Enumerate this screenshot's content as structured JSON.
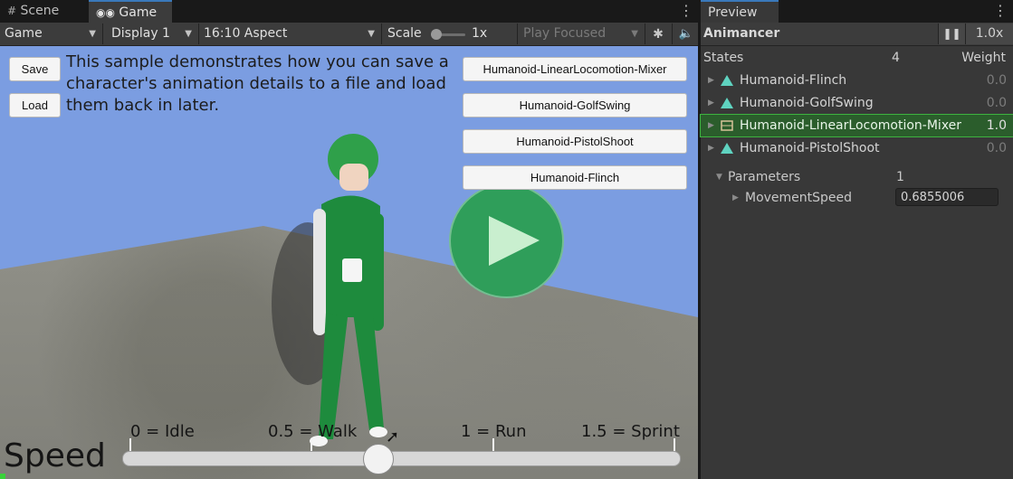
{
  "tabs": {
    "scene": "Scene",
    "game": "Game",
    "preview": "Preview"
  },
  "toolbar": {
    "mode": "Game",
    "display": "Display 1",
    "aspect": "16:10 Aspect",
    "scale_label": "Scale",
    "scale_value": "1x",
    "play_mode": "Play Focused"
  },
  "game": {
    "save_label": "Save",
    "load_label": "Load",
    "description": "This sample demonstrates how you can save a character's animation details to a file and load them back in later.",
    "animation_buttons": [
      "Humanoid-LinearLocomotion-Mixer",
      "Humanoid-GolfSwing",
      "Humanoid-PistolShoot",
      "Humanoid-Flinch"
    ],
    "speed_label": "Speed",
    "speed_value": 0.6855006,
    "speed_ticks": [
      {
        "label": "0 = Idle",
        "value": 0
      },
      {
        "label": "0.5 = Walk",
        "value": 0.5
      },
      {
        "label": "1 = Run",
        "value": 1
      },
      {
        "label": "1.5 = Sprint",
        "value": 1.5
      }
    ]
  },
  "preview": {
    "title": "Animancer",
    "speed": "1.0x",
    "states_label": "States",
    "states_count": "4",
    "weight_label": "Weight",
    "states": [
      {
        "name": "Humanoid-Flinch",
        "weight": "0.0",
        "active": false
      },
      {
        "name": "Humanoid-GolfSwing",
        "weight": "0.0",
        "active": false
      },
      {
        "name": "Humanoid-LinearLocomotion-Mixer",
        "weight": "1.0",
        "active": true
      },
      {
        "name": "Humanoid-PistolShoot",
        "weight": "0.0",
        "active": false
      }
    ],
    "parameters_label": "Parameters",
    "parameters_count": "1",
    "parameter_name": "MovementSpeed",
    "parameter_value": "0.6855006"
  },
  "colors": {
    "play_button": "#2f9e5a",
    "active_state": "#2b5d2c",
    "character_green": "#1f8a3a",
    "sky": "#7b9de1"
  }
}
